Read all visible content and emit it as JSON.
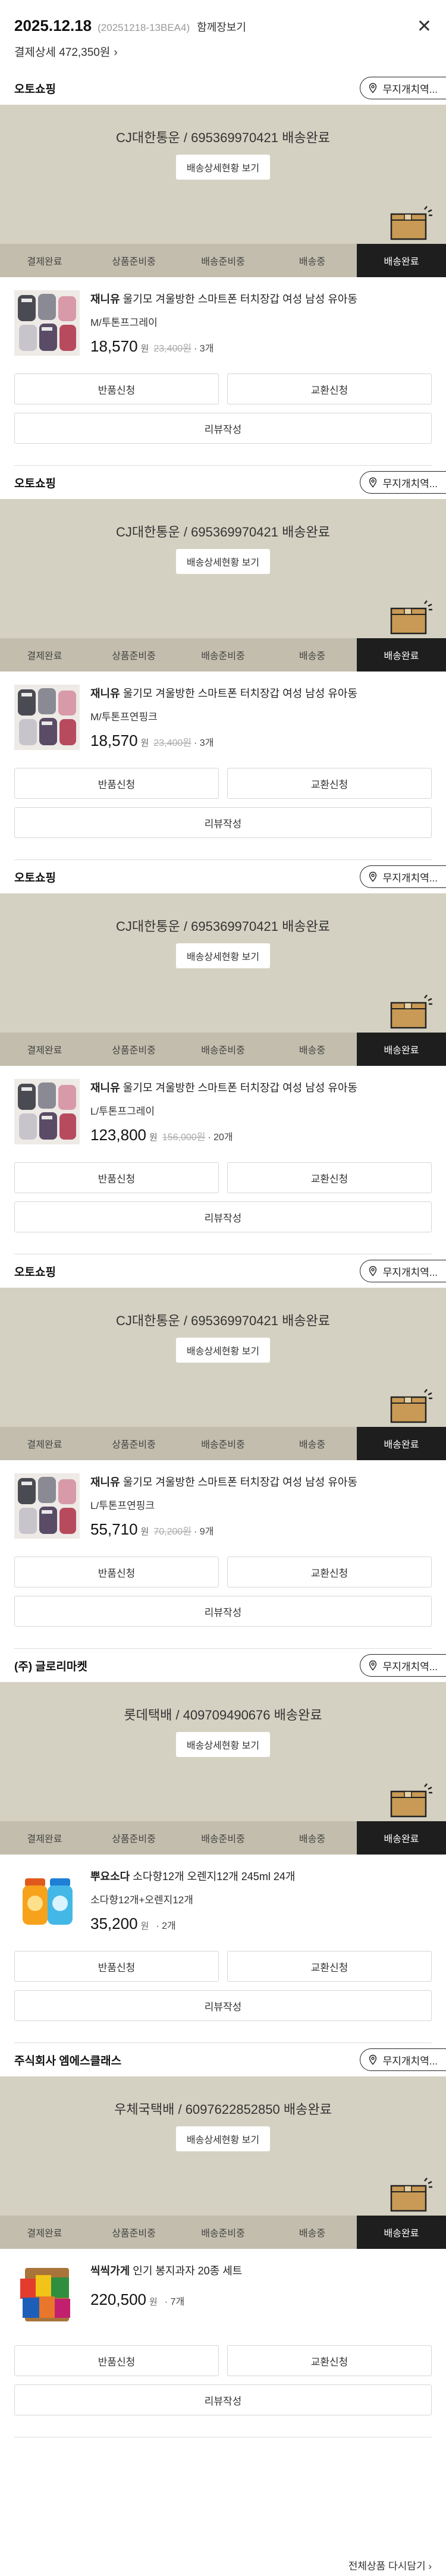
{
  "header": {
    "date": "2025.12.18",
    "order_no": "(20251218-13BEA4)",
    "view_all": "함께장보기",
    "close_icon": "close-icon",
    "payment_label": "결제상세 472,350원",
    "chevron": "›"
  },
  "steps": [
    "결제완료",
    "상품준비중",
    "배송준비중",
    "배송중",
    "배송완료"
  ],
  "store_button_label": "무지개치역...",
  "shipments": [
    {
      "seller": "오토쇼핑",
      "tracking": "CJ대한통운 / 695369970421 배송완료",
      "track_button": "배송상세현황 보기",
      "product": {
        "brand": "재니유",
        "name": "울기모 겨울방한 스마트폰 터치장갑 여성 남성 유아동",
        "option": "M/투톤프그레이",
        "price": "18,570",
        "won": "원",
        "orig_price": "23,400원",
        "qty": "· 3개"
      },
      "actions": {
        "return": "반품신청",
        "exchange": "교환신청",
        "review": "리뷰작성"
      }
    },
    {
      "seller": "오토쇼핑",
      "tracking": "CJ대한통운 / 695369970421 배송완료",
      "track_button": "배송상세현황 보기",
      "product": {
        "brand": "재니유",
        "name": "울기모 겨울방한 스마트폰 터치장갑 여성 남성 유아동",
        "option": "M/투톤프연핑크",
        "price": "18,570",
        "won": "원",
        "orig_price": "23,400원",
        "qty": "· 3개"
      },
      "actions": {
        "return": "반품신청",
        "exchange": "교환신청",
        "review": "리뷰작성"
      }
    },
    {
      "seller": "오토쇼핑",
      "tracking": "CJ대한통운 / 695369970421 배송완료",
      "track_button": "배송상세현황 보기",
      "product": {
        "brand": "재니유",
        "name": "울기모 겨울방한 스마트폰 터치장갑 여성 남성 유아동",
        "option": "L/투톤프그레이",
        "price": "123,800",
        "won": "원",
        "orig_price": "156,000원",
        "qty": "· 20개"
      },
      "actions": {
        "return": "반품신청",
        "exchange": "교환신청",
        "review": "리뷰작성"
      }
    },
    {
      "seller": "오토쇼핑",
      "tracking": "CJ대한통운 / 695369970421 배송완료",
      "track_button": "배송상세현황 보기",
      "product": {
        "brand": "재니유",
        "name": "울기모 겨울방한 스마트폰 터치장갑 여성 남성 유아동",
        "option": "L/투톤프연핑크",
        "price": "55,710",
        "won": "원",
        "orig_price": "70,200원",
        "qty": "· 9개"
      },
      "actions": {
        "return": "반품신청",
        "exchange": "교환신청",
        "review": "리뷰작성"
      }
    },
    {
      "seller": "(주) 글로리마켓",
      "tracking": "롯데택배 / 409709490676 배송완료",
      "track_button": "배송상세현황 보기",
      "product": {
        "brand": "뿌요소다",
        "name": "소다향12개 오렌지12개 245ml 24개",
        "option": "소다향12개+오렌지12개",
        "price": "35,200",
        "won": "원",
        "orig_price": "",
        "qty": "· 2개"
      },
      "actions": {
        "return": "반품신청",
        "exchange": "교환신청",
        "review": "리뷰작성"
      }
    },
    {
      "seller": "주식회사 엠에스클래스",
      "tracking": "우체국택배 / 6097622852850 배송완료",
      "track_button": "배송상세현황 보기",
      "product": {
        "brand": "씩씩가게",
        "name": "인기 봉지과자 20종 세트",
        "option": "",
        "price": "220,500",
        "won": "원",
        "orig_price": "",
        "qty": "· 7개"
      },
      "actions": {
        "return": "반품신청",
        "exchange": "교환신청",
        "review": "리뷰작성"
      }
    }
  ],
  "footer": {
    "add_all": "전체상품 다시담기 ›"
  },
  "colors": {
    "banner": "#d5d1c2",
    "steps_bar": "#c2bdac",
    "active_step": "#1e1e1e"
  }
}
